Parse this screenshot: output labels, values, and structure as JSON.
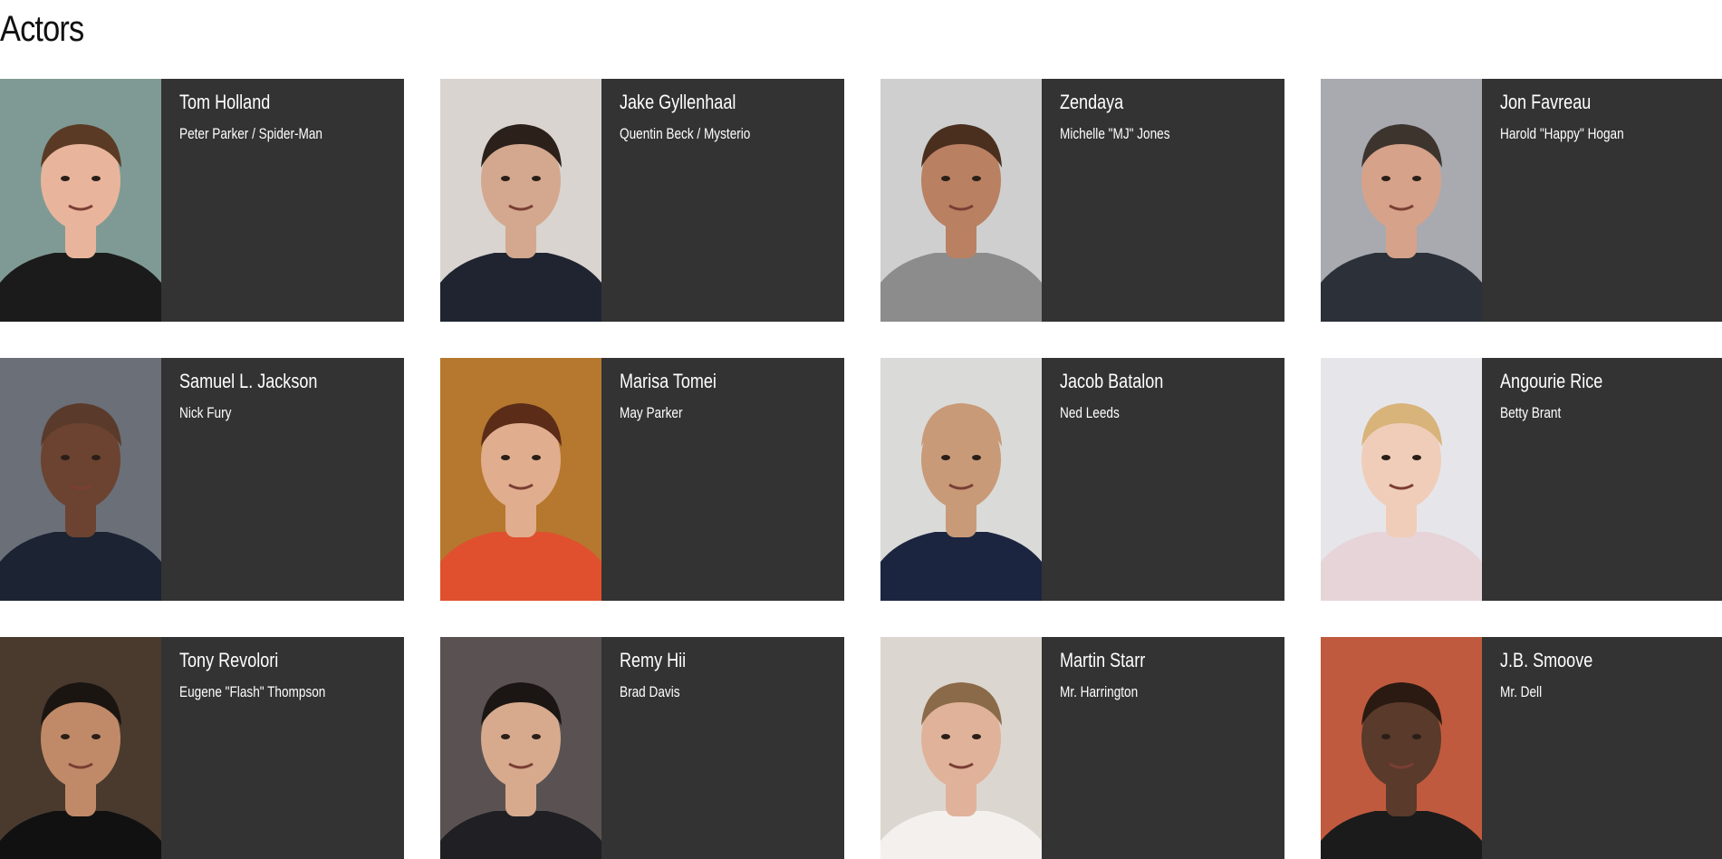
{
  "page": {
    "title": "Actors"
  },
  "actors": [
    {
      "name": "Tom Holland",
      "role": "Peter Parker / Spider-Man",
      "colors": {
        "bg": "#7f9a94",
        "skin": "#e8b59c",
        "hair": "#5a3a24",
        "shirt": "#1b1b1b"
      }
    },
    {
      "name": "Jake Gyllenhaal",
      "role": "Quentin Beck / Mysterio",
      "colors": {
        "bg": "#d9d4d0",
        "skin": "#d4a88e",
        "hair": "#2b201a",
        "shirt": "#1f2430"
      }
    },
    {
      "name": "Zendaya",
      "role": "Michelle \"MJ\" Jones",
      "colors": {
        "bg": "#cfcfcf",
        "skin": "#b98062",
        "hair": "#4a2f1f",
        "shirt": "#8c8c8c"
      }
    },
    {
      "name": "Jon Favreau",
      "role": "Harold \"Happy\" Hogan",
      "colors": {
        "bg": "#a8aab0",
        "skin": "#d6a28a",
        "hair": "#3d342e",
        "shirt": "#2c3038"
      }
    },
    {
      "name": "Samuel L. Jackson",
      "role": "Nick Fury",
      "colors": {
        "bg": "#6a6f78",
        "skin": "#6b4330",
        "hair": "#5a3a2b",
        "shirt": "#1c2333"
      }
    },
    {
      "name": "Marisa Tomei",
      "role": "May Parker",
      "colors": {
        "bg": "#b5782e",
        "skin": "#e0ad8e",
        "hair": "#5b2c18",
        "shirt": "#e0502e"
      }
    },
    {
      "name": "Jacob Batalon",
      "role": "Ned Leeds",
      "colors": {
        "bg": "#dadad8",
        "skin": "#c89a78",
        "hair": "#c89a78",
        "shirt": "#1c2540"
      }
    },
    {
      "name": "Angourie Rice",
      "role": "Betty Brant",
      "colors": {
        "bg": "#e6e6ea",
        "skin": "#f0cdb8",
        "hair": "#d8b37a",
        "shirt": "#e6d4d8"
      }
    },
    {
      "name": "Tony Revolori",
      "role": "Eugene \"Flash\" Thompson",
      "colors": {
        "bg": "#4a3a2e",
        "skin": "#c08a68",
        "hair": "#1b1512",
        "shirt": "#111111"
      }
    },
    {
      "name": "Remy Hii",
      "role": "Brad Davis",
      "colors": {
        "bg": "#5a5252",
        "skin": "#d7aa8e",
        "hair": "#1b1613",
        "shirt": "#1f1f24"
      }
    },
    {
      "name": "Martin Starr",
      "role": "Mr. Harrington",
      "colors": {
        "bg": "#dcd6d0",
        "skin": "#e0b29a",
        "hair": "#8a6a48",
        "shirt": "#f4f0ee"
      }
    },
    {
      "name": "J.B. Smoove",
      "role": "Mr. Dell",
      "colors": {
        "bg": "#c05a3e",
        "skin": "#5a3a2a",
        "hair": "#2a1a12",
        "shirt": "#1b1b1b"
      }
    }
  ]
}
